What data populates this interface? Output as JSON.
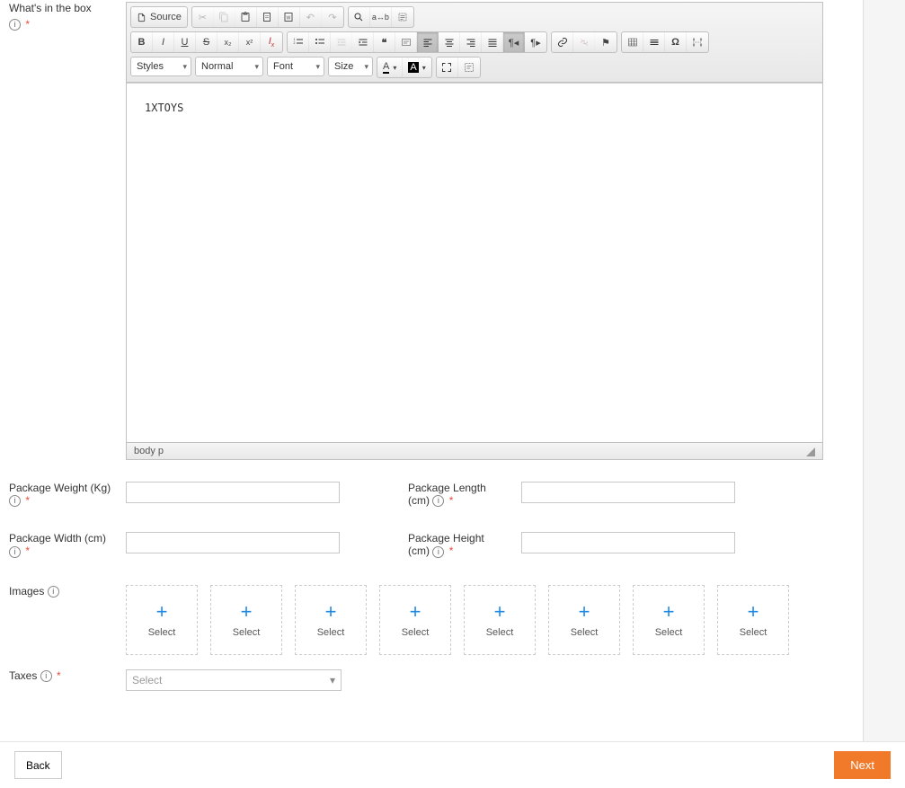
{
  "fields": {
    "whatsInBox": {
      "label": "What's in the box",
      "value": "1XTOYS"
    },
    "packageWeight": {
      "label": "Package Weight (Kg)",
      "value": ""
    },
    "packageLength": {
      "label": "Package Length (cm)",
      "value": ""
    },
    "packageWidth": {
      "label": "Package Width (cm)",
      "value": ""
    },
    "packageHeight": {
      "label": "Package Height (cm)",
      "value": ""
    },
    "images": {
      "label": "Images",
      "slotLabel": "Select",
      "count": 8
    },
    "taxes": {
      "label": "Taxes",
      "placeholder": "Select"
    }
  },
  "editor": {
    "sourceBtn": "Source",
    "styles": "Styles",
    "format": "Normal",
    "font": "Font",
    "size": "Size",
    "textColor": "A",
    "bgColor": "A",
    "breadcrumb": "body  p"
  },
  "footer": {
    "back": "Back",
    "next": "Next"
  },
  "colors": {
    "accent": "#f1792a",
    "link": "#1e88e5"
  }
}
